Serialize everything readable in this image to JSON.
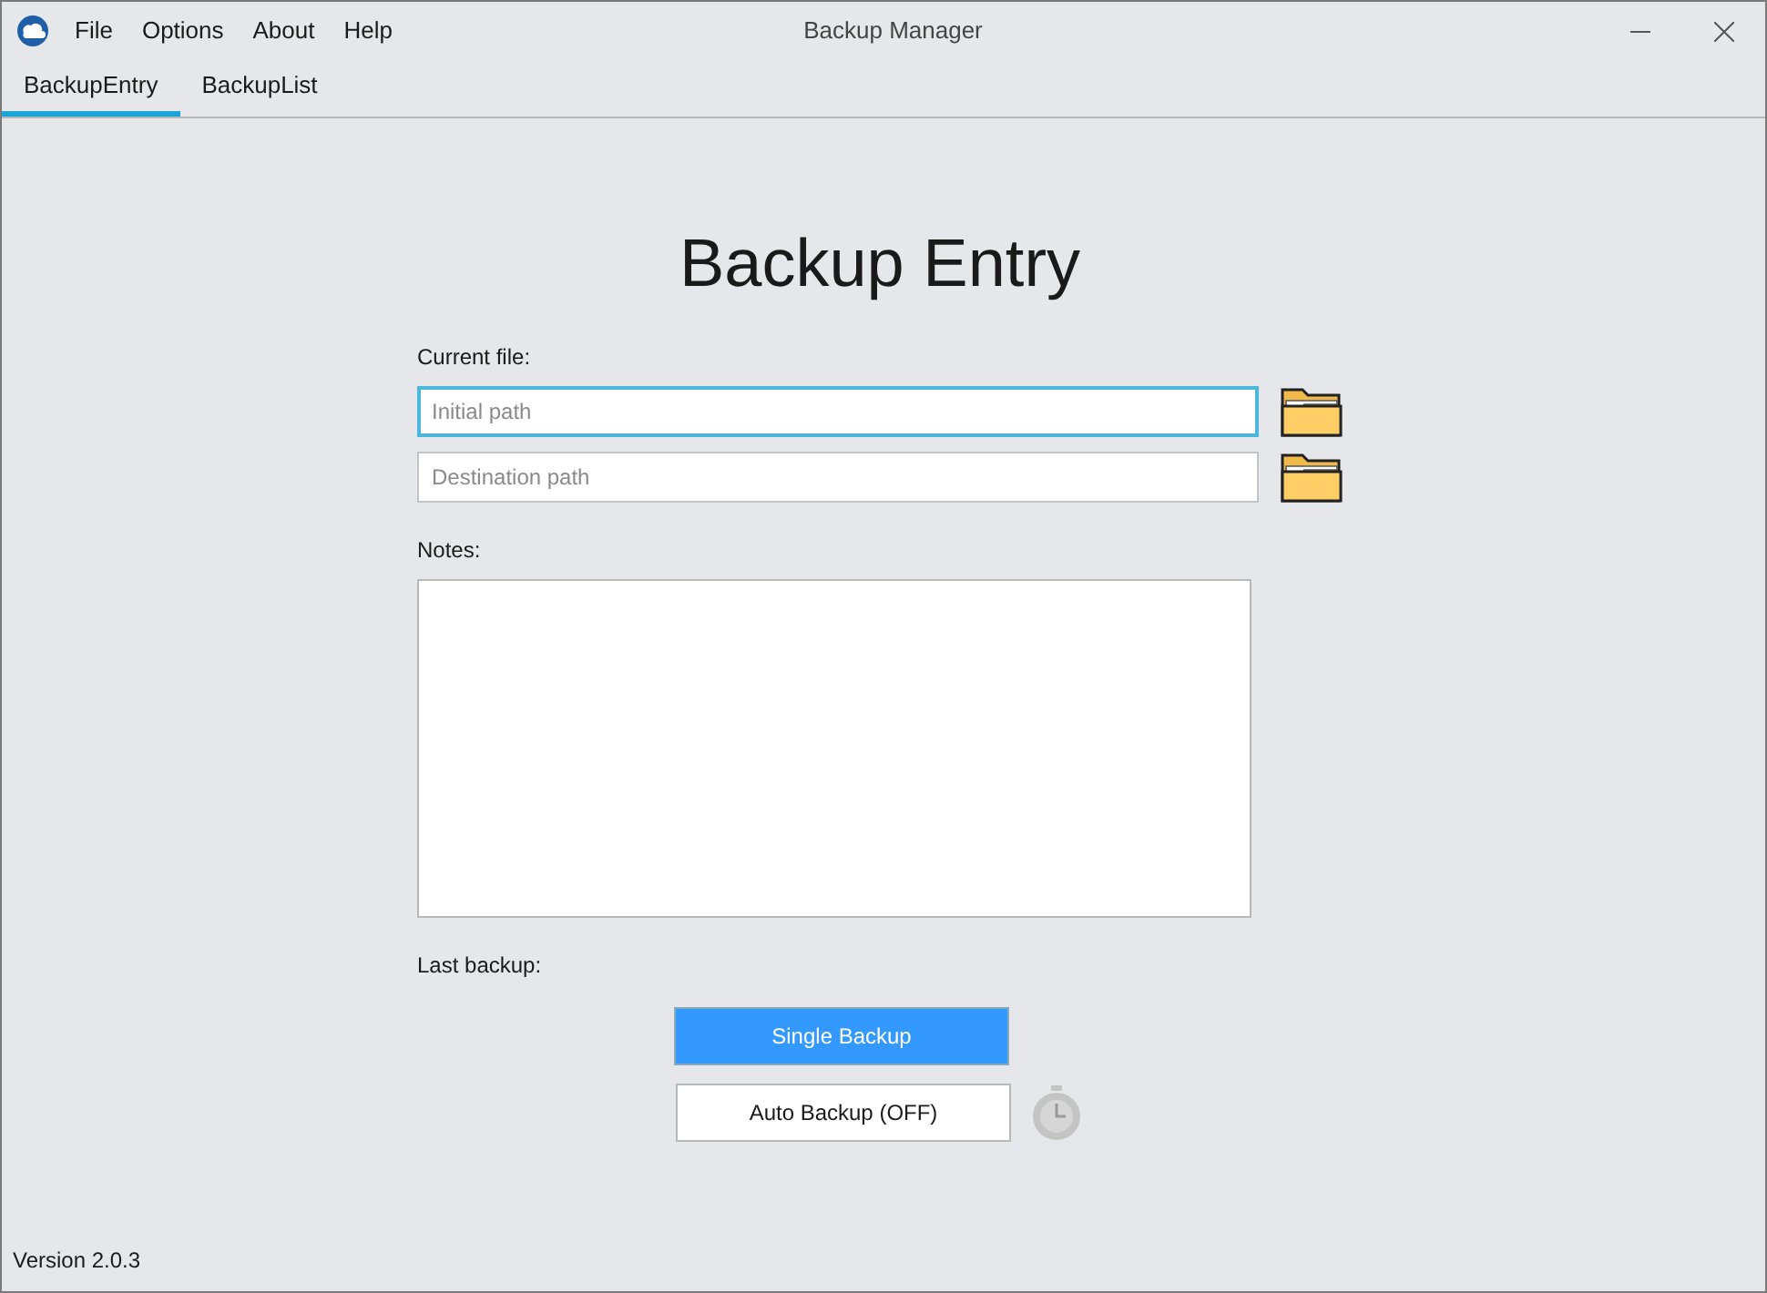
{
  "window": {
    "title": "Backup Manager"
  },
  "menu": [
    "File",
    "Options",
    "About",
    "Help"
  ],
  "tabs": [
    {
      "label": "BackupEntry",
      "selected": true
    },
    {
      "label": "BackupList",
      "selected": false
    }
  ],
  "heading": "Backup Entry",
  "current_file_label": "Current file:",
  "fields": [
    {
      "placeholder": "Initial path",
      "focused": true
    },
    {
      "placeholder": "Destination path",
      "focused": false
    }
  ],
  "notes_label": "Notes:",
  "last_backup_label": "Last backup:",
  "single_backup_button": "Single Backup",
  "auto_backup_button": "Auto Backup (OFF)",
  "status_bar": "Version 2.0.3"
}
